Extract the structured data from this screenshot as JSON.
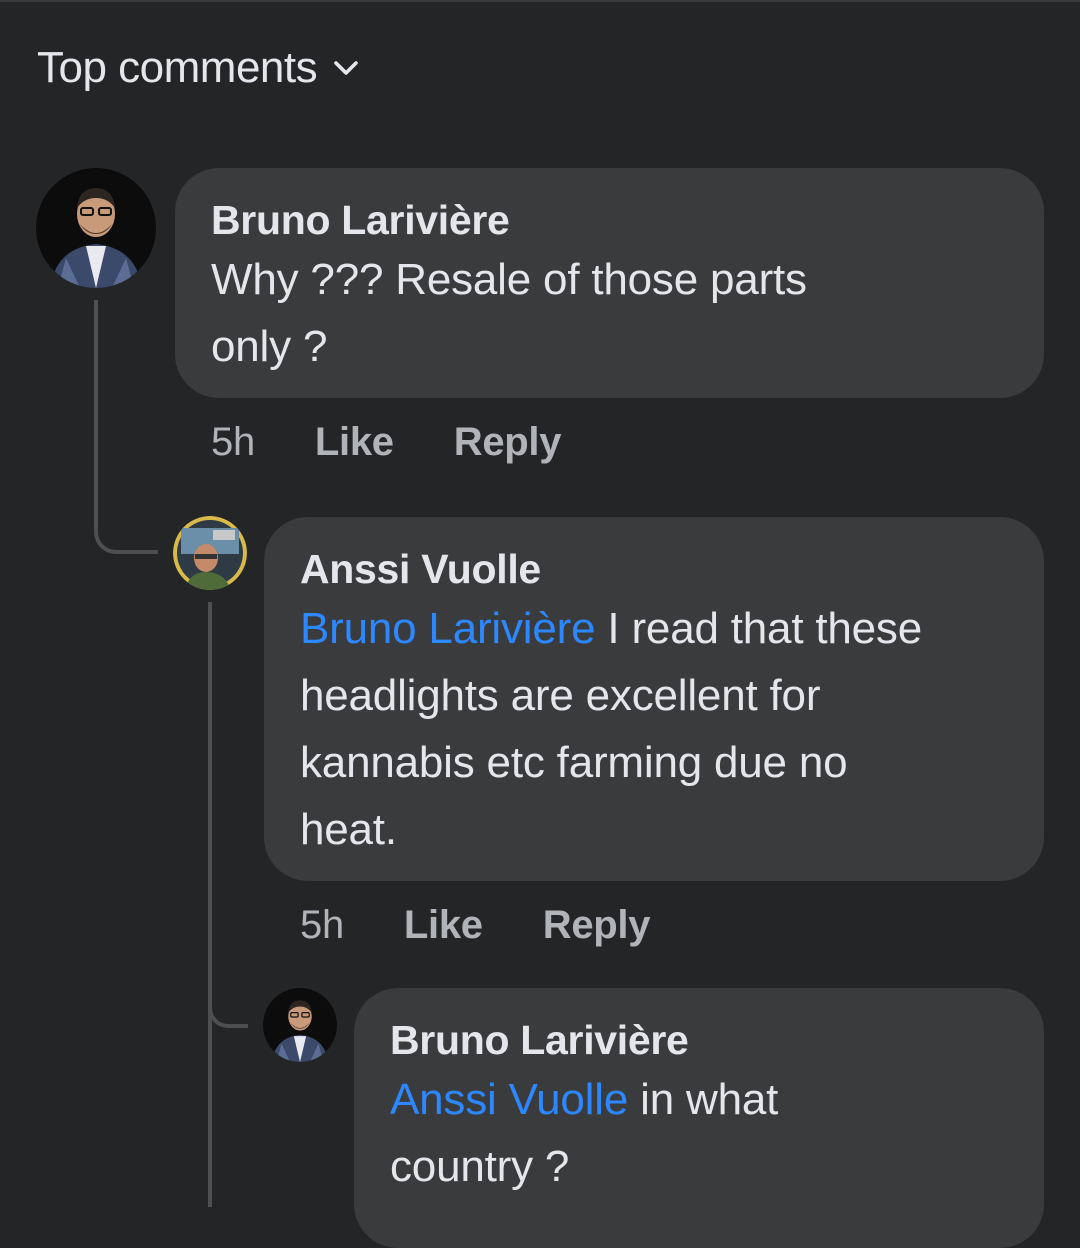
{
  "header": {
    "sort_label": "Top comments",
    "sort_icon": "chevron-down-icon"
  },
  "comments": [
    {
      "author": "Bruno Larivière",
      "text": "Why ??? Resale of those parts only ?",
      "line1": "Why ??? Resale of those parts",
      "line2": "only ?",
      "time": "5h",
      "like_label": "Like",
      "reply_label": "Reply",
      "avatar_icon": "bruno-avatar"
    },
    {
      "author": "Anssi Vuolle",
      "mention": "Bruno Larivière",
      "line1_rest": " I read that these",
      "line2": "headlights are excellent for",
      "line3": "kannabis etc farming due no",
      "line4": "heat.",
      "time": "5h",
      "like_label": "Like",
      "reply_label": "Reply",
      "avatar_icon": "anssi-avatar"
    },
    {
      "author": "Bruno Larivière",
      "mention": "Anssi Vuolle",
      "line1_rest": " in what",
      "line2": "country ?",
      "avatar_icon": "bruno-avatar"
    }
  ],
  "colors": {
    "background": "#242526",
    "bubble": "#3a3b3c",
    "text": "#e4e6eb",
    "secondary": "#b0b3b8",
    "mention": "#2d88ff"
  }
}
